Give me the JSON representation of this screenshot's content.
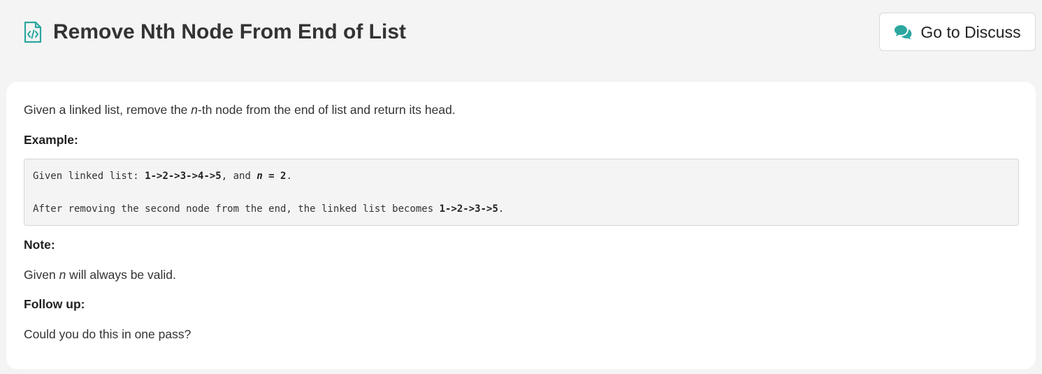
{
  "header": {
    "title": "Remove Nth Node From End of List",
    "title_icon": "code-file-icon",
    "discuss_button": {
      "label": "Go to Discuss",
      "icon": "comments-icon"
    }
  },
  "description": {
    "intro": {
      "before": "Given a linked list, remove the ",
      "italic": "n",
      "after": "-th node from the end of list and return its head."
    },
    "example_heading": "Example:",
    "example": {
      "line1": {
        "prefix": "Given linked list: ",
        "list": "1->2->3->4->5",
        "middle": ", and ",
        "var": "n",
        "equals": " = 2",
        "end": "."
      },
      "line2": {
        "prefix": "After removing the second node from the end, the linked list becomes ",
        "list": "1->2->3->5",
        "end": "."
      }
    },
    "note_heading": "Note:",
    "note": {
      "before": "Given ",
      "italic": "n",
      "after": " will always be valid."
    },
    "followup_heading": "Follow up:",
    "followup": "Could you do this in one pass?"
  },
  "colors": {
    "accent": "#2ba7a0",
    "page_bg": "#f4f4f4",
    "card_bg": "#ffffff",
    "code_bg": "#f4f4f4"
  }
}
